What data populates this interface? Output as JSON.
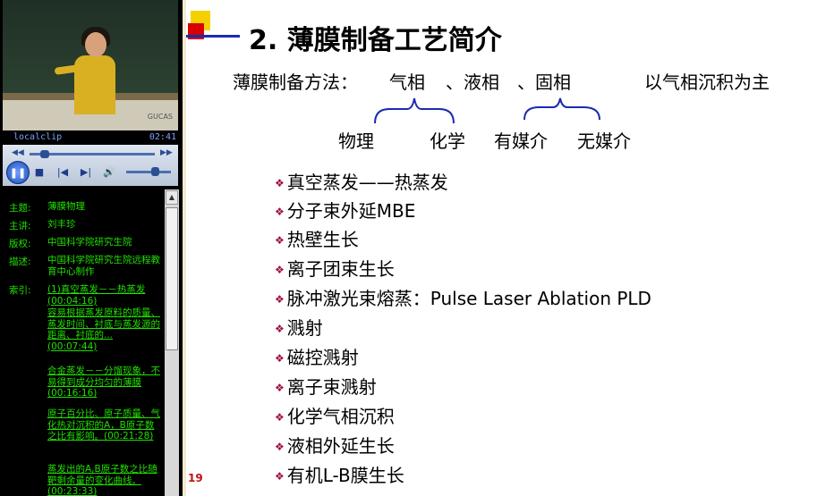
{
  "player": {
    "clip_name": "localclip",
    "time": "02:41"
  },
  "video": {
    "logo": "GUCAS"
  },
  "info": {
    "topic_label": "主题:",
    "topic": "薄膜物理",
    "speaker_label": "主讲:",
    "speaker": "刘丰珍",
    "copyright_label": "版权:",
    "copyright": "中国科学院研究生院",
    "desc_label": "描述:",
    "desc": "中国科学院研究生院远程教育中心制作",
    "index_label": "索引:",
    "index_items": [
      "(1)真空蒸发－－热蒸发(00:04:16)",
      "容易根据蒸发原料的质量、蒸发时间、衬底与蒸发源的距离、衬底的...(00:07:44)",
      "合金蒸发－－分馏现象，不易得到成分均匀的薄膜(00:16:16)",
      "原子百分比、原子质量、气化热对沉积的A，B原子数之比有影响。(00:21:28)",
      "蒸发出的A,B原子数之比随靶剩余量的变化曲线。(00:23:33)"
    ]
  },
  "slide": {
    "title": "2. 薄膜制备工艺简介",
    "methods_label": "薄膜制备方法：",
    "gas": "气相",
    "sep1": "、液相",
    "sep2": "、固相",
    "main_note": "以气相沉积为主",
    "physical": "物理",
    "chemical": "化学",
    "with_medium": "有媒介",
    "without_medium": "无媒介",
    "bullets": [
      "真空蒸发——热蒸发",
      "分子束外延MBE",
      "热壁生长",
      "离子团束生长",
      "脉冲激光束熔蒸：Pulse Laser Ablation PLD",
      "溅射",
      "磁控溅射",
      "离子束溅射",
      "化学气相沉积",
      "液相外延生长",
      "有机L-B膜生长"
    ],
    "page_number": "19"
  }
}
